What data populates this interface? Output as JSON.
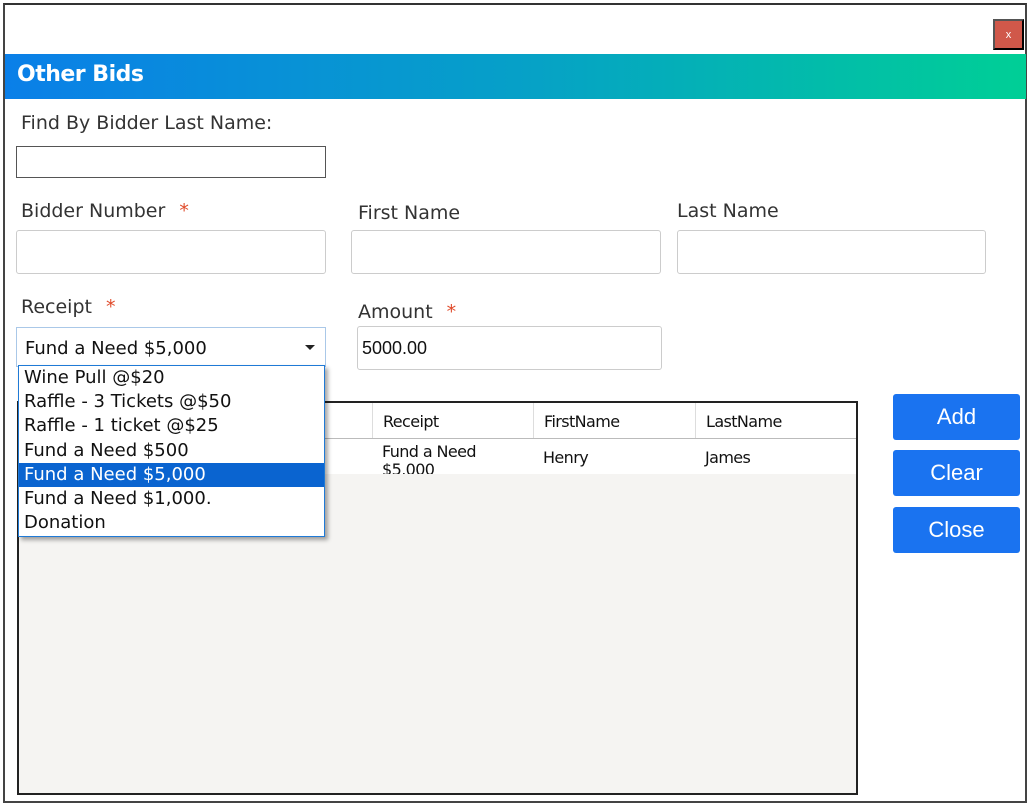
{
  "window": {
    "close_label": "x"
  },
  "title": "Other Bids",
  "find": {
    "label": "Find By Bidder Last Name:",
    "value": ""
  },
  "fields": {
    "bidder_number": {
      "label": "Bidder Number",
      "required": "*",
      "value": ""
    },
    "first_name": {
      "label": "First Name",
      "value": ""
    },
    "last_name": {
      "label": "Last Name",
      "value": ""
    },
    "receipt": {
      "label": "Receipt",
      "required": "*",
      "value": "Fund a Need $5,000",
      "options": [
        "Wine Pull @$20",
        "Raffle - 3 Tickets @$50",
        "Raffle - 1 ticket @$25",
        "Fund a Need $500",
        "Fund a Need $5,000",
        "Fund a Need $1,000.",
        "Donation"
      ],
      "selected_index": 4
    },
    "amount": {
      "label": "Amount",
      "required": "*",
      "value": "5000.00"
    }
  },
  "grid": {
    "columns": [
      "Receipt",
      "FirstName",
      "LastName"
    ],
    "rows": [
      [
        "Fund a Need $5,000",
        "Henry",
        "James"
      ]
    ]
  },
  "buttons": {
    "add": "Add",
    "clear": "Clear",
    "close": "Close"
  },
  "colors": {
    "accent": "#1a73f0",
    "close": "#d0584a",
    "required": "#e04a2a"
  }
}
